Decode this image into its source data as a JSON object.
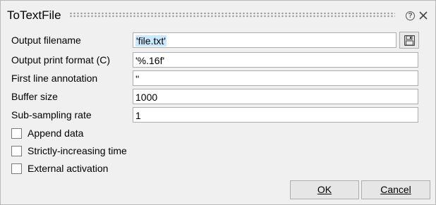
{
  "window": {
    "title": "ToTextFile"
  },
  "fields": [
    {
      "label": "Output filename",
      "value": "'file.txt'"
    },
    {
      "label": "Output print format (C)",
      "value": "'%.16f'"
    },
    {
      "label": "First line annotation",
      "value": "''"
    },
    {
      "label": "Buffer size",
      "value": "1000"
    },
    {
      "label": "Sub-sampling rate",
      "value": "1"
    }
  ],
  "checkboxes": [
    {
      "label": "Append data",
      "checked": false
    },
    {
      "label": "Strictly-increasing time",
      "checked": false
    },
    {
      "label": "External activation",
      "checked": false
    }
  ],
  "buttons": {
    "ok": "OK",
    "cancel": "Cancel"
  },
  "icons": {
    "help": "help-icon",
    "close": "close-icon",
    "save": "save-file-icon"
  }
}
